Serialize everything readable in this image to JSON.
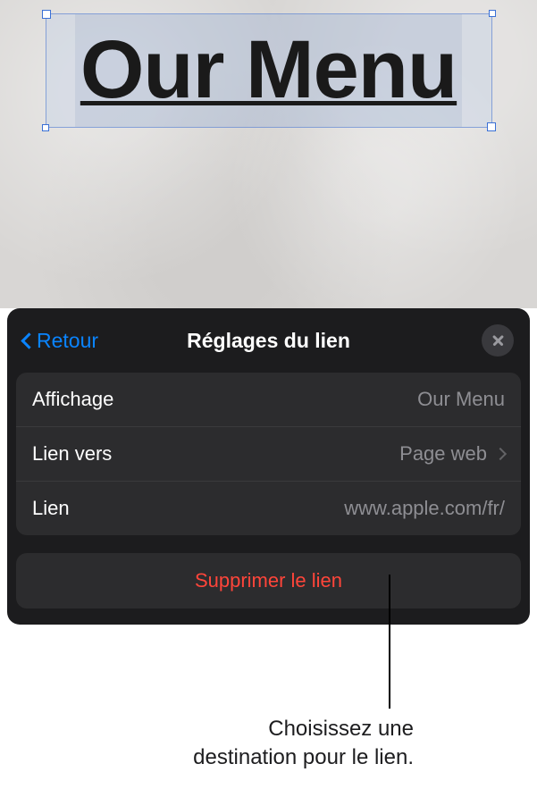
{
  "canvas": {
    "selected_text": "Our Menu"
  },
  "panel": {
    "back_label": "Retour",
    "title": "Réglages du lien",
    "rows": {
      "display": {
        "label": "Affichage",
        "value": "Our Menu"
      },
      "link_to": {
        "label": "Lien vers",
        "value": "Page web"
      },
      "link": {
        "label": "Lien",
        "value": "www.apple.com/fr/"
      }
    },
    "delete_label": "Supprimer le lien"
  },
  "callout": {
    "line1": "Choisissez une",
    "line2": "destination pour le lien."
  }
}
